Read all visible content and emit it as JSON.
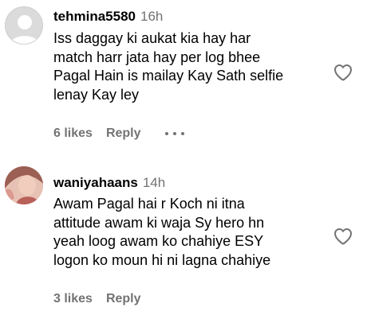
{
  "comments": [
    {
      "username": "tehmina5580",
      "time": "16h",
      "text": "Iss daggay ki aukat kia hay har\nmatch harr jata hay per log bhee\nPagal Hain is mailay Kay Sath selfie\nlenay Kay ley",
      "likes": "6 likes",
      "reply": "Reply",
      "avatar": "default-profile-icon",
      "like_icon": "heart-outline-icon"
    },
    {
      "username": "waniyahaans",
      "time": "14h",
      "text": "Awam Pagal hai r Koch ni itna\nattitude awam ki waja Sy hero hn\nyeah loog awam ko chahiye ESY\nlogon ko moun hi ni lagna chahiye",
      "likes": "3 likes",
      "reply": "Reply",
      "avatar": "profile-photo",
      "like_icon": "heart-outline-icon"
    }
  ],
  "colors": {
    "text": "#000000",
    "secondary_text": "#737373",
    "background": "#ffffff"
  }
}
